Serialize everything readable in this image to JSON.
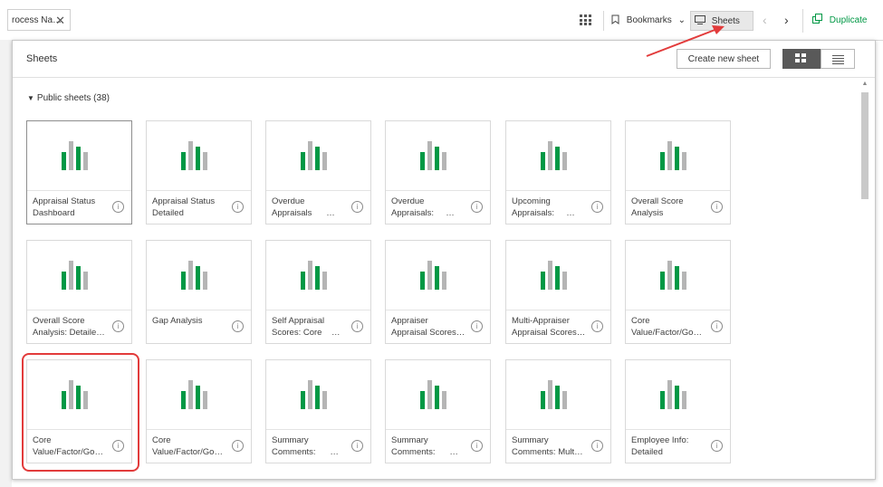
{
  "topbar": {
    "tab_label": "rocess Na…",
    "tab_close": "✕",
    "bookmarks_label": "Bookmarks",
    "sheets_label": "Sheets",
    "chevron": "⌄",
    "prev_arrow": "‹",
    "next_arrow": "›",
    "duplicate_label": "Duplicate"
  },
  "panel": {
    "title": "Sheets",
    "create_label": "Create new sheet",
    "section_label": "Public sheets (38)",
    "section_caret": "▼"
  },
  "colors": {
    "bar_green": "#009845",
    "bar_gray": "#b5b5b5",
    "accent": "#009845",
    "highlight": "#e23b3b"
  },
  "sheets": [
    {
      "name": "Appraisal Status\nDashboard"
    },
    {
      "name": "Appraisal Status\nDetailed"
    },
    {
      "name": "Overdue\nAppraisals      …"
    },
    {
      "name": "Overdue\nAppraisals:     …"
    },
    {
      "name": "Upcoming\nAppraisals:     …"
    },
    {
      "name": "Overall Score\nAnalysis"
    },
    {
      "name": "Overall Score\nAnalysis: Detaile…"
    },
    {
      "name": "Gap Analysis"
    },
    {
      "name": "Self Appraisal\nScores: Core    …"
    },
    {
      "name": "Appraiser\nAppraisal Scores…"
    },
    {
      "name": "Multi-Appraiser\nAppraisal Scores…"
    },
    {
      "name": "Core\nValue/Factor/Go…"
    },
    {
      "name": "Core\nValue/Factor/Go…"
    },
    {
      "name": "Core\nValue/Factor/Go…"
    },
    {
      "name": "Summary\nComments:      …"
    },
    {
      "name": "Summary\nComments:      …"
    },
    {
      "name": "Summary\nComments: Mult…"
    },
    {
      "name": "Employee Info:\nDetailed"
    }
  ],
  "info_glyph": "i"
}
